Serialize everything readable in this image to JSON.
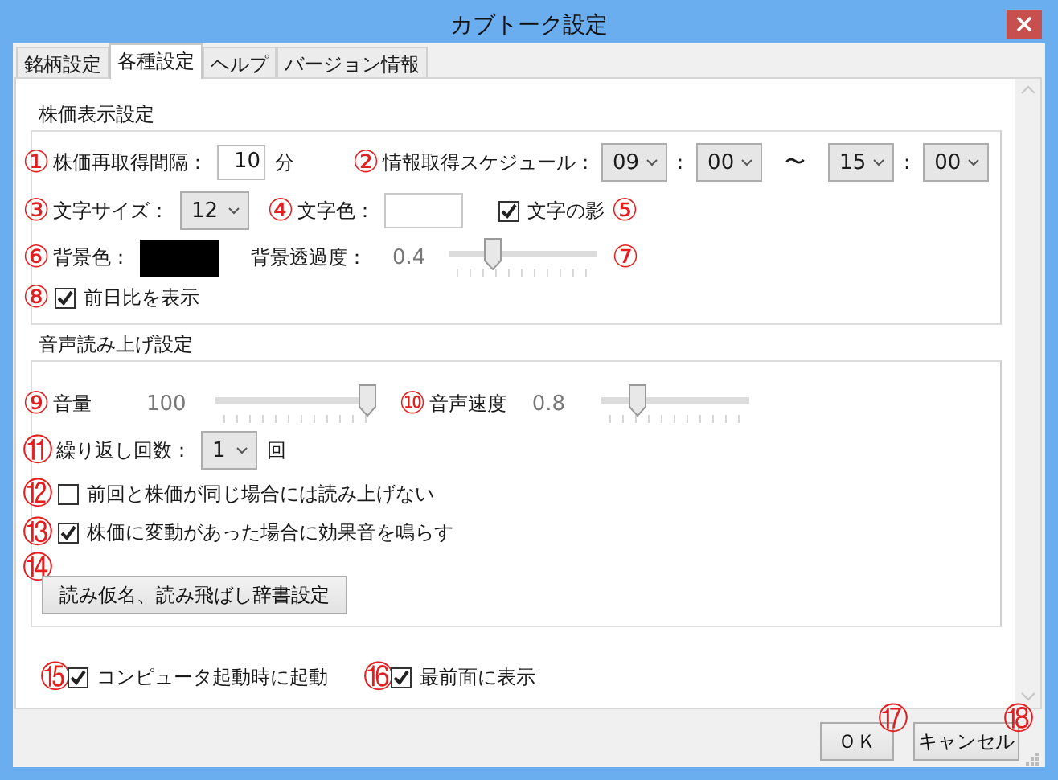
{
  "window": {
    "title": "カブトーク設定"
  },
  "tabs": [
    {
      "label": "銘柄設定",
      "selected": false
    },
    {
      "label": "各種設定",
      "selected": true
    },
    {
      "label": "ヘルプ",
      "selected": false
    },
    {
      "label": "バージョン情報",
      "selected": false
    }
  ],
  "price_display": {
    "title": "株価表示設定",
    "refresh_interval": {
      "marker": "①",
      "label": "株価再取得間隔：",
      "value": "10",
      "unit": "分"
    },
    "schedule": {
      "marker": "②",
      "label": "情報取得スケジュール：",
      "start_hour": "09",
      "start_colon": ":",
      "start_minute": "00",
      "range_sign": "〜",
      "end_hour": "15",
      "end_colon": ":",
      "end_minute": "00"
    },
    "font_size": {
      "marker": "③",
      "label": "文字サイズ：",
      "value": "12"
    },
    "text_color": {
      "marker": "④",
      "label": "文字色：",
      "color": "#ffffff"
    },
    "text_shadow": {
      "label": "文字の影",
      "checked": true,
      "marker": "⑤"
    },
    "background_color": {
      "marker": "⑥",
      "label": "背景色：",
      "color": "#000000"
    },
    "background_opacity": {
      "label": "背景透過度：",
      "reading": "0.4",
      "level": 0.28,
      "marker": "⑦"
    },
    "show_change": {
      "marker": "⑧",
      "label": "前日比を表示",
      "checked": true
    }
  },
  "speech": {
    "title": "音声読み上げ設定",
    "volume": {
      "marker": "⑨",
      "label": "音量",
      "reading": "100",
      "level": 1
    },
    "speed": {
      "marker": "⑩",
      "label": "音声速度",
      "reading": "0.8",
      "level": 0.22
    },
    "repeat": {
      "marker": "⑪",
      "label": "繰り返し回数：",
      "value": "1",
      "unit": "回"
    },
    "options": [
      {
        "marker": "⑫",
        "label": "前回と株価が同じ場合には読み上げない",
        "checked": false
      },
      {
        "marker": "⑬",
        "label": "株価に変動があった場合に効果音を鳴らす",
        "checked": true
      }
    ],
    "dictionary_button": {
      "marker": "⑭",
      "label": "読み仮名、読み飛ばし辞書設定"
    }
  },
  "general_options": [
    {
      "marker": "⑮",
      "label": "コンピュータ起動時に起動",
      "checked": true
    },
    {
      "marker": "⑯",
      "label": "最前面に表示",
      "checked": true
    }
  ],
  "buttons": [
    {
      "marker": "⑰",
      "label": "ＯＫ"
    },
    {
      "marker": "⑱",
      "label": "キャンセル"
    }
  ]
}
